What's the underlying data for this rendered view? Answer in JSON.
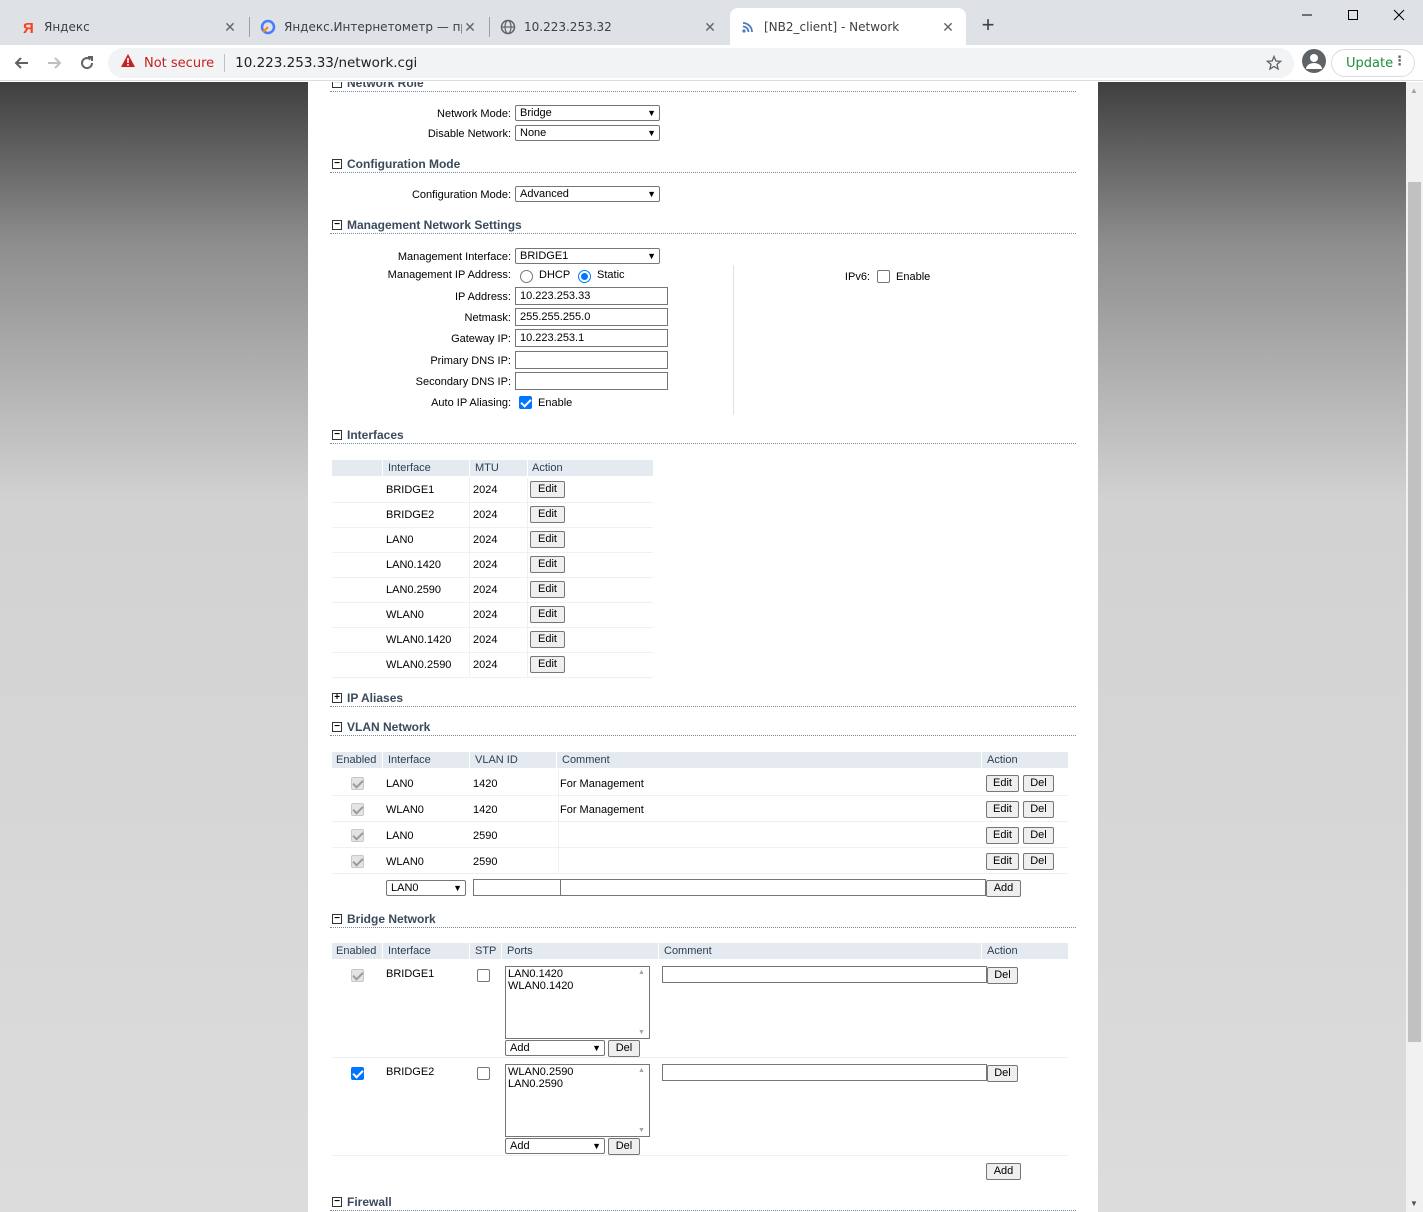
{
  "browser": {
    "tabs": [
      {
        "title": "Яндекс",
        "icon": "yandex-icon"
      },
      {
        "title": "Яндекс.Интернетометр — прове",
        "icon": "internetometer-icon"
      },
      {
        "title": "10.223.253.32",
        "icon": "globe-icon"
      },
      {
        "title": "[NB2_client] - Network",
        "icon": "wifi-icon",
        "active": true
      }
    ],
    "new_tab": "+",
    "not_secure": "Not secure",
    "url": "10.223.253.33/network.cgi",
    "update_label": "Update"
  },
  "sections": {
    "network_role": "Network Role",
    "configuration_mode": "Configuration Mode",
    "management": "Management Network Settings",
    "interfaces": "Interfaces",
    "ip_aliases": "IP Aliases",
    "vlan": "VLAN Network",
    "bridge": "Bridge Network",
    "firewall": "Firewall"
  },
  "network_role": {
    "network_mode_label": "Network Mode:",
    "network_mode_value": "Bridge",
    "disable_network_label": "Disable Network:",
    "disable_network_value": "None"
  },
  "configuration_mode": {
    "label": "Configuration Mode:",
    "value": "Advanced"
  },
  "management": {
    "interface_label": "Management Interface:",
    "interface_value": "BRIDGE1",
    "ip_address_mode_label": "Management IP Address:",
    "dhcp_label": "DHCP",
    "static_label": "Static",
    "ip_label": "IP Address:",
    "ip_value": "10.223.253.33",
    "netmask_label": "Netmask:",
    "netmask_value": "255.255.255.0",
    "gateway_label": "Gateway IP:",
    "gateway_value": "10.223.253.1",
    "primary_dns_label": "Primary DNS IP:",
    "primary_dns_value": "",
    "secondary_dns_label": "Secondary DNS IP:",
    "secondary_dns_value": "",
    "auto_alias_label": "Auto IP Aliasing:",
    "enable_label": "Enable",
    "ipv6_label": "IPv6:",
    "ipv6_enable_label": "Enable"
  },
  "interfaces": {
    "headers": {
      "interface": "Interface",
      "mtu": "MTU",
      "action": "Action"
    },
    "edit_label": "Edit",
    "rows": [
      {
        "name": "BRIDGE1",
        "mtu": "2024"
      },
      {
        "name": "BRIDGE2",
        "mtu": "2024"
      },
      {
        "name": "LAN0",
        "mtu": "2024"
      },
      {
        "name": "LAN0.1420",
        "mtu": "2024"
      },
      {
        "name": "LAN0.2590",
        "mtu": "2024"
      },
      {
        "name": "WLAN0",
        "mtu": "2024"
      },
      {
        "name": "WLAN0.1420",
        "mtu": "2024"
      },
      {
        "name": "WLAN0.2590",
        "mtu": "2024"
      }
    ]
  },
  "vlan": {
    "headers": {
      "enabled": "Enabled",
      "interface": "Interface",
      "vlan_id": "VLAN ID",
      "comment": "Comment",
      "action": "Action"
    },
    "edit_label": "Edit",
    "del_label": "Del",
    "add_label": "Add",
    "new_interface": "LAN0",
    "rows": [
      {
        "interface": "LAN0",
        "vlan_id": "1420",
        "comment": "For Management"
      },
      {
        "interface": "WLAN0",
        "vlan_id": "1420",
        "comment": "For Management"
      },
      {
        "interface": "LAN0",
        "vlan_id": "2590",
        "comment": ""
      },
      {
        "interface": "WLAN0",
        "vlan_id": "2590",
        "comment": ""
      }
    ]
  },
  "bridge": {
    "headers": {
      "enabled": "Enabled",
      "interface": "Interface",
      "stp": "STP",
      "ports": "Ports",
      "comment": "Comment",
      "action": "Action"
    },
    "del_label": "Del",
    "add_select": "Add",
    "add_label": "Add",
    "rows": [
      {
        "interface": "BRIDGE1",
        "ports": [
          "LAN0.1420",
          "WLAN0.1420"
        ],
        "enabled": true,
        "editable": false
      },
      {
        "interface": "BRIDGE2",
        "ports": [
          "WLAN0.2590",
          "LAN0.2590"
        ],
        "enabled": true,
        "editable": true
      }
    ]
  },
  "colors": {
    "section_title": "#3a4a5c",
    "table_header_bg": "#e4eaf0",
    "checkbox_accent": "#0075ff",
    "not_secure": "#c5221f",
    "update_green": "#1e8e3e"
  }
}
